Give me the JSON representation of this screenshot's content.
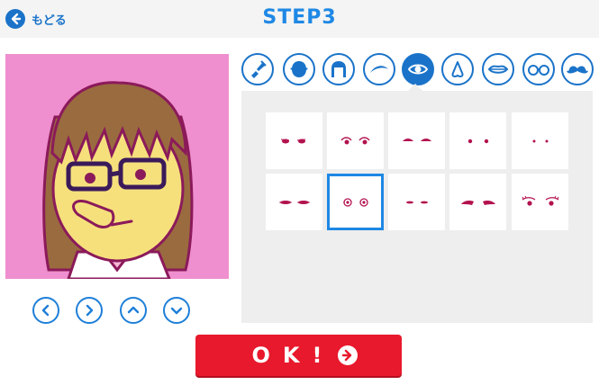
{
  "header": {
    "back_label": "もどる",
    "title": "STEP3"
  },
  "categories": [
    {
      "name": "paint-icon"
    },
    {
      "name": "face-shape-icon"
    },
    {
      "name": "hair-icon"
    },
    {
      "name": "eyebrow-icon"
    },
    {
      "name": "eye-icon",
      "selected": true
    },
    {
      "name": "nose-icon"
    },
    {
      "name": "mouth-icon"
    },
    {
      "name": "glasses-icon"
    },
    {
      "name": "mustache-icon"
    }
  ],
  "nav_arrows": [
    "chevron-left-icon",
    "chevron-right-icon",
    "chevron-up-icon",
    "chevron-down-icon"
  ],
  "eye_options_selected_index": 6,
  "ok_button": {
    "label": "OK!"
  },
  "colors": {
    "brand_blue": "#1a73c9",
    "avatar_background": "#ef8fcf",
    "ok_red": "#e8192c",
    "panel_gray": "#eeeeee"
  }
}
